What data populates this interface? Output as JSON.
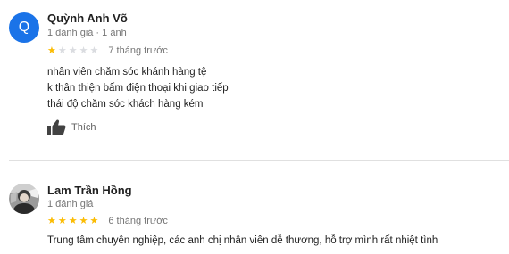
{
  "colors": {
    "star_filled": "#FBBC04",
    "star_empty": "#DADCE0",
    "avatar_q": "#1A73E8",
    "secondary_text": "#757575"
  },
  "reviews": [
    {
      "author_name": "Quỳnh Anh Võ",
      "avatar_letter": "Q",
      "meta": "1 đánh giá · 1 ảnh",
      "rating": 1,
      "time_ago": "7 tháng trước",
      "lines": [
        "nhân viên chăm sóc khánh hàng tệ",
        "k thân thiện bấm điện thoại khi giao tiếp",
        "thái độ chăm sóc khách hàng kém"
      ],
      "like_icon": "thumbs-up-icon",
      "like_label": "Thích"
    },
    {
      "author_name": "Lam Trần Hồng",
      "avatar_icon": "profile-photo",
      "meta": "1 đánh giá",
      "rating": 5,
      "time_ago": "6 tháng trước",
      "lines": [
        "Trung tâm chuyên nghiệp, các anh chị nhân viên dễ thương, hỗ trợ mình rất nhiệt tình"
      ]
    }
  ]
}
